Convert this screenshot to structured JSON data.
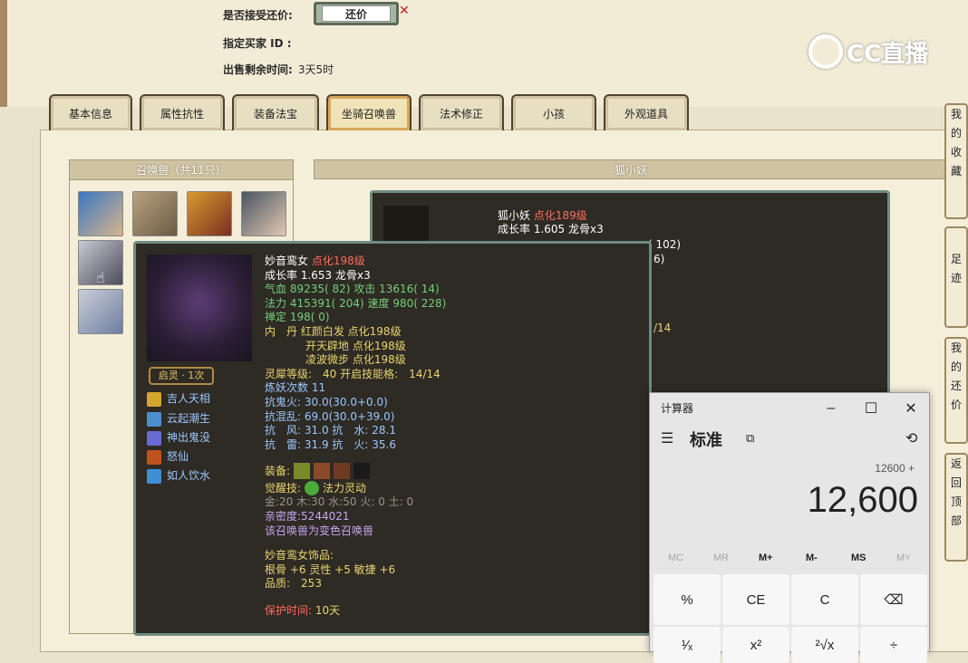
{
  "header": {
    "accept_counter_label": "是否接受还价:",
    "counter_button": "还价",
    "buyer_id_label": "指定买家 ID :",
    "remaining_label": "出售剩余时间:",
    "remaining_value": "3天5时"
  },
  "watermark": {
    "text": "CC直播"
  },
  "tabs": [
    "基本信息",
    "属性抗性",
    "装备法宝",
    "坐骑召唤兽",
    "法术修正",
    "小孩",
    "外观道具"
  ],
  "active_tab": "坐骑召唤兽",
  "summon_list": {
    "title": "召唤兽（共11只）"
  },
  "detail": {
    "title": "狐小妖"
  },
  "fox": {
    "name": "狐小妖",
    "level": "点化189级",
    "growth": "成长率 1.605 龙骨x3",
    "frag1": "( 102)",
    "frag2": "6)",
    "frag3": "/14"
  },
  "tooltip": {
    "name": "妙音鸾女",
    "level": "点化198级",
    "growth": "成长率 1.653 龙骨x3",
    "hp": "气血 89235( 82)",
    "atk": "攻击 13616( 14)",
    "mp": "法力 415391( 204)",
    "spd": "速度 980( 228)",
    "med": "禅定 198( 0)",
    "inner_label": "内　丹",
    "inner1": "红颜白发 点化198级",
    "inner2": "开天辟地 点化198级",
    "inner3": "凌波微步 点化198级",
    "soul": "灵犀等级:　40 开启技能格:　14/14",
    "refine": "炼妖次数 11",
    "r1": "抗鬼火: 30.0(30.0+0.0)",
    "r2": "抗混乱: 69.0(30.0+39.0)",
    "r3": "抗　风: 31.0 抗　水: 28.1",
    "r4": "抗　雷: 31.9 抗　火: 35.6",
    "equip_label": "装备:",
    "awaken_label": "觉醒技:",
    "awaken_value": "法力灵动",
    "elements": "金:20 木:30 水:50 火: 0 土: 0",
    "intimacy": "亲密度:5244021",
    "variant": "该召唤兽为变色召唤兽",
    "deco_title": "妙音鸾女饰品:",
    "deco_attr": "根骨 +6 灵性 +5 敏捷 +6",
    "quality": "品质:　253",
    "protect_label": "保护时间:",
    "protect_value": "10天",
    "badge": "启灵 · 1次",
    "skills": [
      "吉人天相",
      "云起潮生",
      "神出鬼没",
      "怒仙",
      "如人饮水"
    ]
  },
  "calculator": {
    "title": "计算器",
    "mode": "标准",
    "expression": "12600 +",
    "display": "12,600",
    "memory": [
      "MC",
      "MR",
      "M+",
      "M-",
      "MS",
      "M˅"
    ],
    "keys_row1": [
      "%",
      "CE",
      "C",
      "⌫"
    ],
    "keys_row2": [
      "¹⁄ₓ",
      "x²",
      "²√x",
      "÷"
    ]
  },
  "side_tabs": [
    [
      "我",
      "的",
      "收",
      "藏"
    ],
    [
      "足",
      "迹"
    ],
    [
      "我",
      "的",
      "还",
      "价"
    ],
    [
      "返",
      "回",
      "顶",
      "部"
    ]
  ]
}
